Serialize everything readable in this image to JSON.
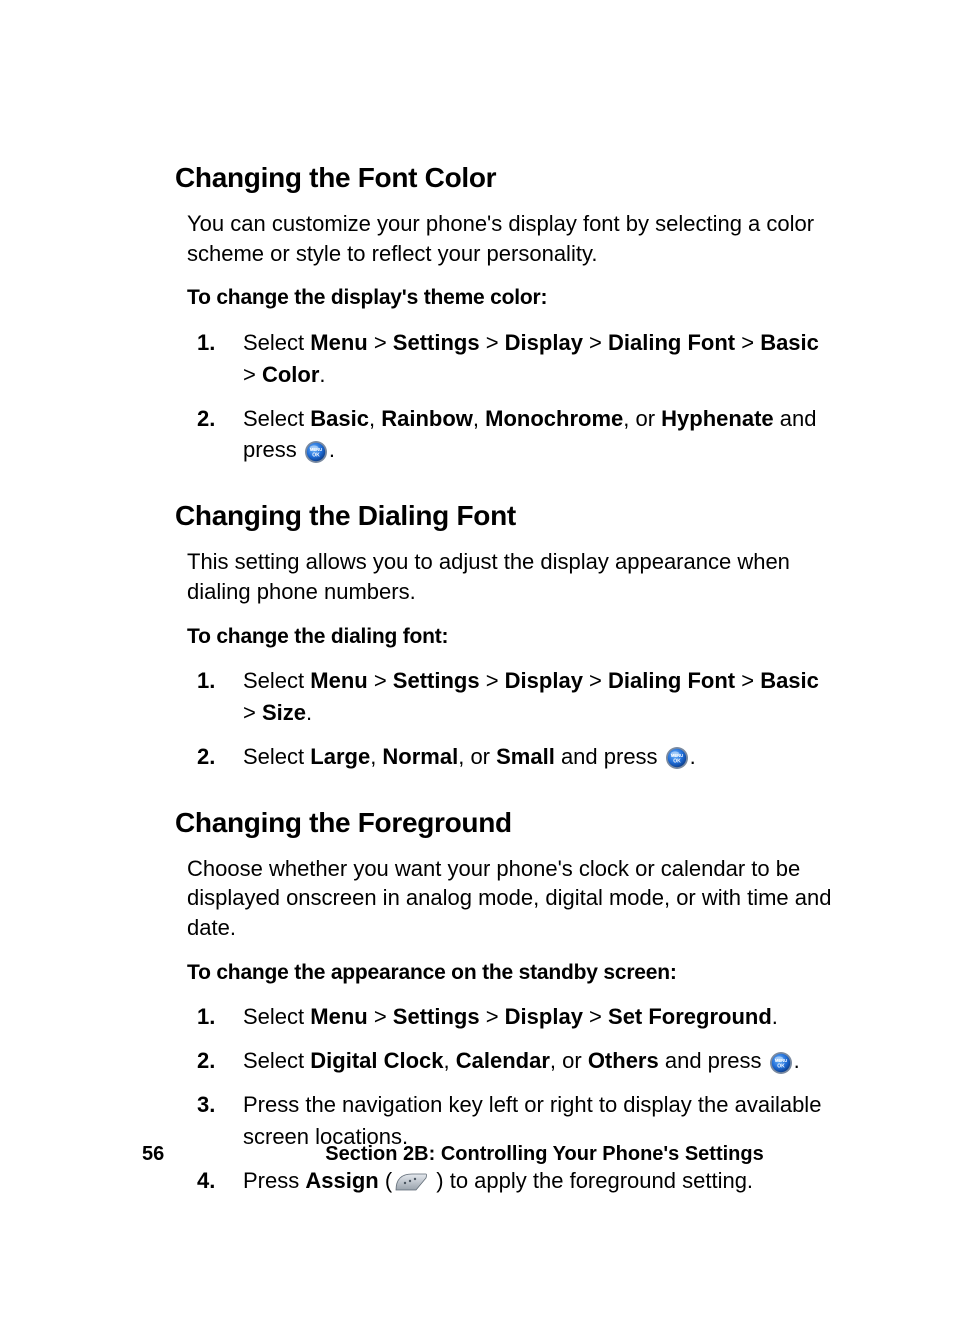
{
  "sections": [
    {
      "heading": "Changing the Font Color",
      "intro": "You can customize your phone's display font by selecting a color scheme or style to reflect your personality.",
      "lead": "To change the display's theme color:",
      "steps": [
        {
          "prefix": "Select ",
          "path": [
            "Menu",
            "Settings",
            "Display",
            "Dialing Font",
            "Basic",
            "Color"
          ],
          "suffix_after_path": "."
        },
        {
          "prefix": "Select ",
          "options": [
            "Basic",
            "Rainbow",
            "Monochrome",
            "Hyphenate"
          ],
          "options_last_joiner": ", or ",
          "after_options": " and press ",
          "icon": "menu-ok",
          "suffix": "."
        }
      ]
    },
    {
      "heading": "Changing the Dialing Font",
      "intro": "This setting allows you to adjust the display appearance when dialing phone numbers.",
      "lead": "To change the dialing font:",
      "steps": [
        {
          "prefix": "Select ",
          "path": [
            "Menu",
            "Settings",
            "Display",
            "Dialing Font",
            "Basic",
            "Size"
          ],
          "suffix_after_path": "."
        },
        {
          "prefix": "Select ",
          "options": [
            "Large",
            "Normal",
            "Small"
          ],
          "options_last_joiner": ", or ",
          "after_options": " and press ",
          "icon": "menu-ok",
          "suffix": "."
        }
      ]
    },
    {
      "heading": "Changing the Foreground",
      "intro": "Choose whether you want your phone's clock or calendar to be displayed onscreen in analog mode, digital mode, or with time and date.",
      "lead": "To change the appearance on the standby screen:",
      "steps": [
        {
          "prefix": "Select ",
          "path": [
            "Menu",
            "Settings",
            "Display",
            "Set Foreground"
          ],
          "suffix_after_path": "."
        },
        {
          "prefix": "Select ",
          "options": [
            "Digital Clock",
            "Calendar",
            "Others"
          ],
          "options_last_joiner": ", or ",
          "after_options": " and press ",
          "icon": "menu-ok",
          "suffix": "."
        },
        {
          "plain": "Press the navigation key left or right to display the available screen locations."
        },
        {
          "prefix": "Press ",
          "bold_word": "Assign",
          "after_bold": " (",
          "icon": "softkey-left",
          "after_icon": " ) to apply the foreground setting."
        }
      ]
    }
  ],
  "footer": {
    "page_number": "56",
    "section_label": "Section 2B: Controlling Your Phone's Settings"
  },
  "glyphs": {
    "path_separator": " > "
  }
}
